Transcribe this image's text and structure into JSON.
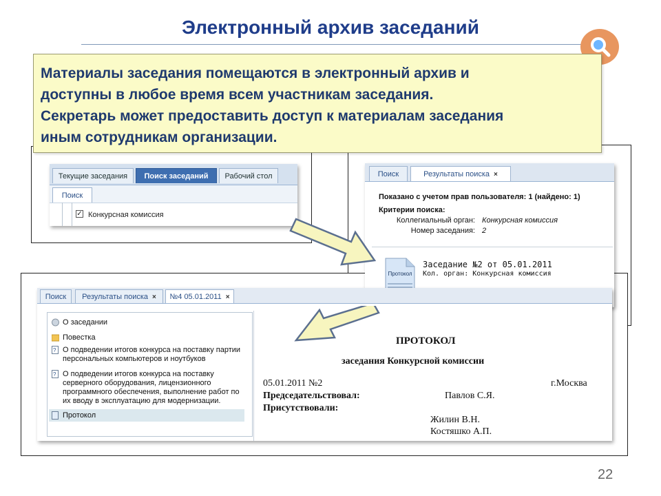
{
  "slide": {
    "title": "Электронный архив заседаний",
    "description_lines": [
      "Материалы заседания помещаются в электронный архив и",
      "доступны в любое время всем участникам заседания.",
      "Секретарь может предоставить доступ к материалам заседания",
      "иным сотрудникам организации."
    ],
    "page_number": "22"
  },
  "panel_a": {
    "tabs": [
      "Текущие заседания",
      "Поиск заседаний",
      "Рабочий стол"
    ],
    "sub_tab": "Поиск",
    "checkbox_label": "Конкурсная комиссия",
    "checkbox_checked": true
  },
  "panel_b": {
    "tabs": [
      "Поиск",
      "Результаты поиска"
    ],
    "close_glyph": "×",
    "summary": "Показано с учетом прав пользователя: 1 (найдено: 1)",
    "criteria_header": "Критерии поиска:",
    "criteria": [
      {
        "label": "Коллегиальный орган:",
        "value": "Конкурсная комиссия"
      },
      {
        "label": "Номер заседания:",
        "value": "2"
      }
    ],
    "result": {
      "icon_label": "Протокол",
      "title": "Заседание №2 от 05.01.2011",
      "subtitle": "Кол. орган: Конкурсная комиссия"
    }
  },
  "panel_c": {
    "tabs": [
      "Поиск",
      "Результаты поиска",
      "№4 05.01.2011"
    ],
    "close_glyph": "×",
    "tree": [
      {
        "icon": "info-icon",
        "label": "О заседании"
      },
      {
        "icon": "folder-icon",
        "label": "Повестка"
      },
      {
        "icon": "question-doc-icon",
        "label": "О подведении итогов конкурса на поставку партии персональных компьютеров и ноутбуков"
      },
      {
        "icon": "question-doc-icon",
        "label": "О подведении итогов конкурса на поставку серверного оборудования, лицензионного программного обеспечения, выполнение работ по их вводу в эксплуатацию для модернизации."
      },
      {
        "icon": "document-icon",
        "label": "Протокол"
      }
    ],
    "document": {
      "heading": "ПРОТОКОЛ",
      "subheading": "заседания Конкурсной комиссии",
      "date_number": "05.01.2011 №2",
      "city": "г.Москва",
      "chair_label": "Председательствовал:",
      "chair_name": "Павлов С.Я.",
      "present_label": "Присутствовали:",
      "present_names": [
        "Жилин В.Н.",
        "Костяшко А.П."
      ]
    }
  },
  "colors": {
    "title": "#1f3d8a",
    "callout_bg": "#fbfbc8",
    "callout_text": "#1f3a6e",
    "search_badge": "#e8965f",
    "arrow_fill": "#f7f5bf"
  }
}
